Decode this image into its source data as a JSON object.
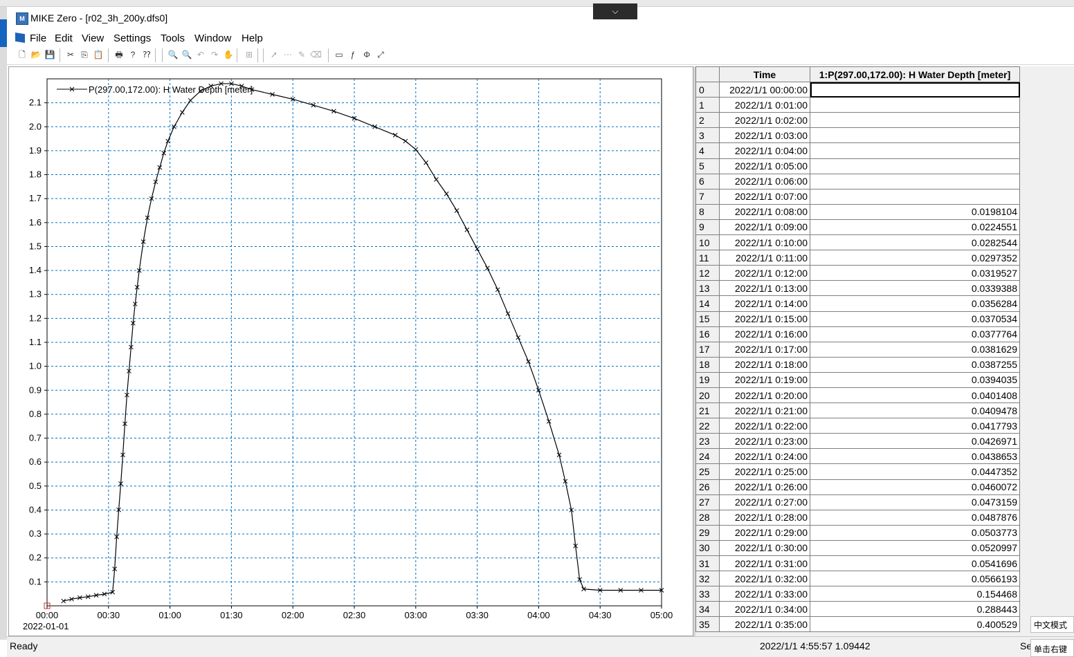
{
  "window": {
    "title": "MIKE Zero - [r02_3h_200y.dfs0]",
    "app_icon": "mike-zero-app-icon",
    "collapse_glyph": "⌵"
  },
  "menu": {
    "items": [
      "File",
      "Edit",
      "View",
      "Settings",
      "Tools",
      "Window",
      "Help"
    ]
  },
  "toolbar": {
    "buttons": [
      {
        "name": "new-file-icon",
        "glyph": "🗋",
        "enabled": true
      },
      {
        "name": "open-file-icon",
        "glyph": "📂",
        "enabled": true
      },
      {
        "name": "save-icon",
        "glyph": "💾",
        "enabled": true
      },
      {
        "name": "cut-icon",
        "glyph": "✂",
        "enabled": true
      },
      {
        "name": "copy-icon",
        "glyph": "⎘",
        "enabled": true
      },
      {
        "name": "paste-icon",
        "glyph": "📋",
        "enabled": true
      },
      {
        "name": "print-icon",
        "glyph": "🖶",
        "enabled": true
      },
      {
        "name": "help-icon",
        "glyph": "?",
        "enabled": true
      },
      {
        "name": "context-help-icon",
        "glyph": "⁇",
        "enabled": true
      },
      {
        "name": "zoom-in-icon",
        "glyph": "🔍",
        "enabled": false
      },
      {
        "name": "zoom-out-icon",
        "glyph": "🔍",
        "enabled": false
      },
      {
        "name": "zoom-previous-icon",
        "glyph": "↶",
        "enabled": false
      },
      {
        "name": "zoom-next-icon",
        "glyph": "↷",
        "enabled": false
      },
      {
        "name": "pan-icon",
        "glyph": "✋",
        "enabled": false
      },
      {
        "name": "zoom-extent-icon",
        "glyph": "⊞",
        "enabled": false
      },
      {
        "name": "select-pointer-icon",
        "glyph": "➚",
        "enabled": false
      },
      {
        "name": "edit-points-icon",
        "glyph": "⋯",
        "enabled": false
      },
      {
        "name": "draw-line-icon",
        "glyph": "✎",
        "enabled": false
      },
      {
        "name": "eraser-icon",
        "glyph": "⌫",
        "enabled": false
      },
      {
        "name": "rectangle-select-icon",
        "glyph": "▭",
        "enabled": true
      },
      {
        "name": "function-icon",
        "glyph": "ƒ",
        "enabled": true
      },
      {
        "name": "interpolate-icon",
        "glyph": "Φ",
        "enabled": true
      },
      {
        "name": "scale-icon",
        "glyph": "⤢",
        "enabled": true
      }
    ]
  },
  "chart_data": {
    "type": "line",
    "legend": "P(297.00,172.00): H Water Depth [meter]",
    "legend_position": "top-left",
    "xlabel": "",
    "ylabel": "",
    "x_unit": "minutes since 2022-01-01 00:00",
    "xlim": [
      0,
      300
    ],
    "ylim": [
      0,
      2.2
    ],
    "grid": true,
    "x_ticks": [
      "00:00",
      "00:30",
      "01:00",
      "01:30",
      "02:00",
      "02:30",
      "03:00",
      "03:30",
      "04:00",
      "04:30",
      "05:00"
    ],
    "x_date_label": "2022-01-01",
    "y_ticks": [
      "0.1",
      "0.2",
      "0.3",
      "0.4",
      "0.5",
      "0.6",
      "0.7",
      "0.8",
      "0.9",
      "1.0",
      "1.1",
      "1.2",
      "1.3",
      "1.4",
      "1.5",
      "1.6",
      "1.7",
      "1.8",
      "1.9",
      "2.0",
      "2.1"
    ],
    "series": [
      {
        "name": "P(297.00,172.00): H Water Depth [meter]",
        "color": "#000000",
        "marker": "x",
        "points": [
          [
            8,
            0.02
          ],
          [
            12,
            0.028
          ],
          [
            16,
            0.034
          ],
          [
            20,
            0.038
          ],
          [
            24,
            0.044
          ],
          [
            28,
            0.049
          ],
          [
            32,
            0.057
          ],
          [
            33,
            0.154
          ],
          [
            34,
            0.288
          ],
          [
            35,
            0.401
          ],
          [
            36,
            0.51
          ],
          [
            37,
            0.63
          ],
          [
            38,
            0.76
          ],
          [
            39,
            0.88
          ],
          [
            40,
            0.98
          ],
          [
            41,
            1.08
          ],
          [
            42,
            1.18
          ],
          [
            43,
            1.26
          ],
          [
            44,
            1.33
          ],
          [
            45,
            1.4
          ],
          [
            47,
            1.52
          ],
          [
            49,
            1.62
          ],
          [
            51,
            1.7
          ],
          [
            53,
            1.77
          ],
          [
            55,
            1.83
          ],
          [
            57,
            1.89
          ],
          [
            59,
            1.94
          ],
          [
            62,
            2.0
          ],
          [
            66,
            2.06
          ],
          [
            70,
            2.11
          ],
          [
            75,
            2.15
          ],
          [
            80,
            2.17
          ],
          [
            85,
            2.18
          ],
          [
            90,
            2.18
          ],
          [
            95,
            2.17
          ],
          [
            100,
            2.155
          ],
          [
            110,
            2.135
          ],
          [
            120,
            2.115
          ],
          [
            130,
            2.09
          ],
          [
            140,
            2.065
          ],
          [
            150,
            2.035
          ],
          [
            160,
            2.0
          ],
          [
            170,
            1.965
          ],
          [
            175,
            1.94
          ],
          [
            180,
            1.905
          ],
          [
            185,
            1.85
          ],
          [
            190,
            1.78
          ],
          [
            195,
            1.72
          ],
          [
            200,
            1.65
          ],
          [
            205,
            1.57
          ],
          [
            210,
            1.49
          ],
          [
            215,
            1.41
          ],
          [
            220,
            1.32
          ],
          [
            225,
            1.22
          ],
          [
            230,
            1.12
          ],
          [
            235,
            1.02
          ],
          [
            240,
            0.9
          ],
          [
            245,
            0.77
          ],
          [
            250,
            0.63
          ],
          [
            253,
            0.52
          ],
          [
            256,
            0.4
          ],
          [
            258,
            0.25
          ],
          [
            260,
            0.11
          ],
          [
            262,
            0.07
          ],
          [
            270,
            0.065
          ],
          [
            280,
            0.065
          ],
          [
            290,
            0.065
          ],
          [
            300,
            0.065
          ]
        ]
      }
    ]
  },
  "table": {
    "columns": [
      "",
      "Time",
      "1:P(297.00,172.00): H Water Depth [meter]"
    ],
    "rows": [
      {
        "idx": "0",
        "time": "2022/1/1 00:00:00",
        "value": ""
      },
      {
        "idx": "1",
        "time": "2022/1/1 0:01:00",
        "value": ""
      },
      {
        "idx": "2",
        "time": "2022/1/1 0:02:00",
        "value": ""
      },
      {
        "idx": "3",
        "time": "2022/1/1 0:03:00",
        "value": ""
      },
      {
        "idx": "4",
        "time": "2022/1/1 0:04:00",
        "value": ""
      },
      {
        "idx": "5",
        "time": "2022/1/1 0:05:00",
        "value": ""
      },
      {
        "idx": "6",
        "time": "2022/1/1 0:06:00",
        "value": ""
      },
      {
        "idx": "7",
        "time": "2022/1/1 0:07:00",
        "value": ""
      },
      {
        "idx": "8",
        "time": "2022/1/1 0:08:00",
        "value": "0.0198104"
      },
      {
        "idx": "9",
        "time": "2022/1/1 0:09:00",
        "value": "0.0224551"
      },
      {
        "idx": "10",
        "time": "2022/1/1 0:10:00",
        "value": "0.0282544"
      },
      {
        "idx": "11",
        "time": "2022/1/1 0:11:00",
        "value": "0.0297352"
      },
      {
        "idx": "12",
        "time": "2022/1/1 0:12:00",
        "value": "0.0319527"
      },
      {
        "idx": "13",
        "time": "2022/1/1 0:13:00",
        "value": "0.0339388"
      },
      {
        "idx": "14",
        "time": "2022/1/1 0:14:00",
        "value": "0.0356284"
      },
      {
        "idx": "15",
        "time": "2022/1/1 0:15:00",
        "value": "0.0370534"
      },
      {
        "idx": "16",
        "time": "2022/1/1 0:16:00",
        "value": "0.0377764"
      },
      {
        "idx": "17",
        "time": "2022/1/1 0:17:00",
        "value": "0.0381629"
      },
      {
        "idx": "18",
        "time": "2022/1/1 0:18:00",
        "value": "0.0387255"
      },
      {
        "idx": "19",
        "time": "2022/1/1 0:19:00",
        "value": "0.0394035"
      },
      {
        "idx": "20",
        "time": "2022/1/1 0:20:00",
        "value": "0.0401408"
      },
      {
        "idx": "21",
        "time": "2022/1/1 0:21:00",
        "value": "0.0409478"
      },
      {
        "idx": "22",
        "time": "2022/1/1 0:22:00",
        "value": "0.0417793"
      },
      {
        "idx": "23",
        "time": "2022/1/1 0:23:00",
        "value": "0.0426971"
      },
      {
        "idx": "24",
        "time": "2022/1/1 0:24:00",
        "value": "0.0438653"
      },
      {
        "idx": "25",
        "time": "2022/1/1 0:25:00",
        "value": "0.0447352"
      },
      {
        "idx": "26",
        "time": "2022/1/1 0:26:00",
        "value": "0.0460072"
      },
      {
        "idx": "27",
        "time": "2022/1/1 0:27:00",
        "value": "0.0473159"
      },
      {
        "idx": "28",
        "time": "2022/1/1 0:28:00",
        "value": "0.0487876"
      },
      {
        "idx": "29",
        "time": "2022/1/1 0:29:00",
        "value": "0.0503773"
      },
      {
        "idx": "30",
        "time": "2022/1/1 0:30:00",
        "value": "0.0520997"
      },
      {
        "idx": "31",
        "time": "2022/1/1 0:31:00",
        "value": "0.0541696"
      },
      {
        "idx": "32",
        "time": "2022/1/1 0:32:00",
        "value": "0.0566193"
      },
      {
        "idx": "33",
        "time": "2022/1/1 0:33:00",
        "value": "0.154468"
      },
      {
        "idx": "34",
        "time": "2022/1/1 0:34:00",
        "value": "0.288443"
      },
      {
        "idx": "35",
        "time": "2022/1/1 0:35:00",
        "value": "0.400529"
      }
    ],
    "selected_row": 0
  },
  "status": {
    "left": "Ready",
    "cursor_readout": "2022/1/1 4:55:57 1.09442",
    "right_fragment": "Se"
  },
  "ime": {
    "mode_label": "中文模式",
    "hint_label": "单击右键"
  },
  "colors": {
    "grid": "#0070c0",
    "series": "#000000",
    "origin_marker": "#d03030"
  }
}
